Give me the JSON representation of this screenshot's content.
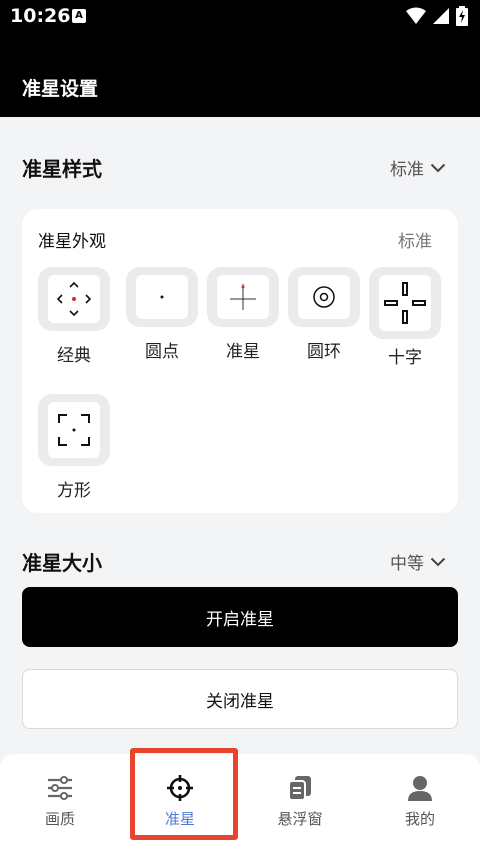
{
  "status": {
    "time": "10:26",
    "badge": "A"
  },
  "app": {
    "title": "准星设置"
  },
  "style_section": {
    "title": "准星样式",
    "value": "标准"
  },
  "appearance_card": {
    "title": "准星外观",
    "value": "标准",
    "items": [
      {
        "label": "经典",
        "icon": "classic-crosshair-icon"
      },
      {
        "label": "圆点",
        "icon": "dot-crosshair-icon"
      },
      {
        "label": "准星",
        "icon": "plus-crosshair-icon"
      },
      {
        "label": "圆环",
        "icon": "ring-crosshair-icon"
      },
      {
        "label": "十字",
        "icon": "cross-crosshair-icon"
      },
      {
        "label": "方形",
        "icon": "square-crosshair-icon"
      }
    ]
  },
  "size_section": {
    "title": "准星大小",
    "value": "中等"
  },
  "buttons": {
    "start": "开启准星",
    "stop": "关闭准星"
  },
  "nav": {
    "items": [
      {
        "label": "画质",
        "icon": "sliders-icon"
      },
      {
        "label": "准星",
        "icon": "crosshair-icon"
      },
      {
        "label": "悬浮窗",
        "icon": "floating-window-icon"
      },
      {
        "label": "我的",
        "icon": "user-icon"
      }
    ],
    "active_index": 1
  },
  "colors": {
    "accent": "#4f7bd8",
    "highlight": "#e8452e",
    "dot_red": "#e0262a"
  }
}
